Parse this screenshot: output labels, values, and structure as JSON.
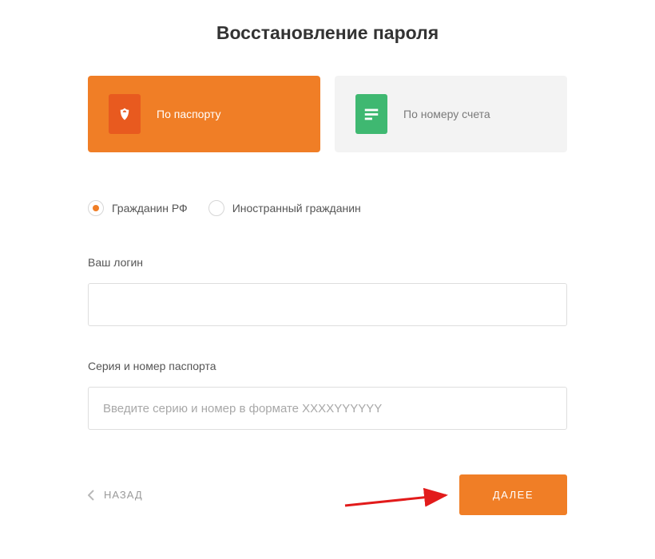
{
  "title": "Восстановление пароля",
  "methods": {
    "passport": {
      "label": "По паспорту"
    },
    "account": {
      "label": "По номеру счета"
    }
  },
  "citizenship": {
    "rf": {
      "label": "Гражданин РФ"
    },
    "foreign": {
      "label": "Иностранный гражданин"
    }
  },
  "fields": {
    "login": {
      "label": "Ваш логин",
      "value": ""
    },
    "passport": {
      "label": "Серия и номер паспорта",
      "placeholder": "Введите серию и номер в формате XXXXYYYYYY",
      "value": ""
    }
  },
  "buttons": {
    "back": "НАЗАД",
    "next": "ДАЛЕЕ"
  }
}
